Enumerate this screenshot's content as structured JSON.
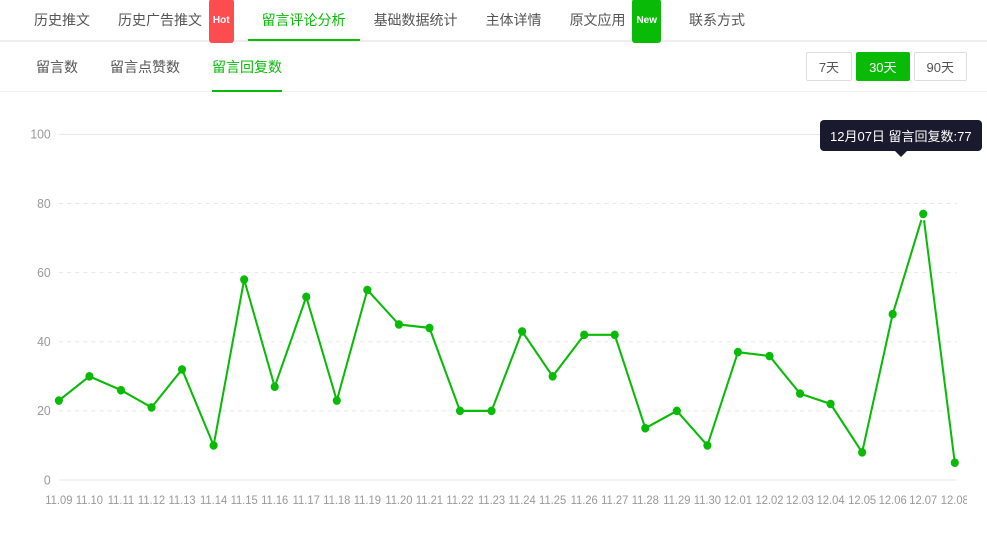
{
  "nav": {
    "items": [
      {
        "label": "历史推文",
        "active": false,
        "badge": null
      },
      {
        "label": "历史广告推文",
        "active": false,
        "badge": {
          "text": "Hot",
          "type": "hot"
        }
      },
      {
        "label": "留言评论分析",
        "active": true,
        "badge": null
      },
      {
        "label": "基础数据统计",
        "active": false,
        "badge": null
      },
      {
        "label": "主体详情",
        "active": false,
        "badge": null
      },
      {
        "label": "原文应用",
        "active": false,
        "badge": {
          "text": "New",
          "type": "new"
        }
      },
      {
        "label": "联系方式",
        "active": false,
        "badge": null
      }
    ]
  },
  "sub_tabs": {
    "items": [
      {
        "label": "留言数",
        "active": false
      },
      {
        "label": "留言点赞数",
        "active": false
      },
      {
        "label": "留言回复数",
        "active": true
      }
    ],
    "time_buttons": [
      {
        "label": "7天",
        "active": false
      },
      {
        "label": "30天",
        "active": true
      },
      {
        "label": "90天",
        "active": false
      }
    ]
  },
  "tooltip": {
    "text": "12月07日 留言回复数:77"
  },
  "chart": {
    "y_labels": [
      "100",
      "80",
      "60",
      "40",
      "20",
      "0"
    ],
    "x_labels": [
      "11.09",
      "11.10",
      "11.11",
      "11.12",
      "11.13",
      "11.14",
      "11.15",
      "11.16",
      "11.17",
      "11.18",
      "11.19",
      "11.20",
      "11.21",
      "11.22",
      "11.23",
      "11.24",
      "11.25",
      "11.26",
      "11.27",
      "11.28",
      "11.29",
      "11.30",
      "12.01",
      "12.02",
      "12.03",
      "12.04",
      "12.05",
      "12.06",
      "12.07",
      "12.08"
    ],
    "data_points": [
      23,
      30,
      26,
      21,
      32,
      10,
      58,
      27,
      53,
      23,
      55,
      45,
      44,
      20,
      20,
      43,
      30,
      42,
      42,
      15,
      20,
      10,
      37,
      36,
      25,
      22,
      8,
      48,
      77,
      5
    ]
  }
}
